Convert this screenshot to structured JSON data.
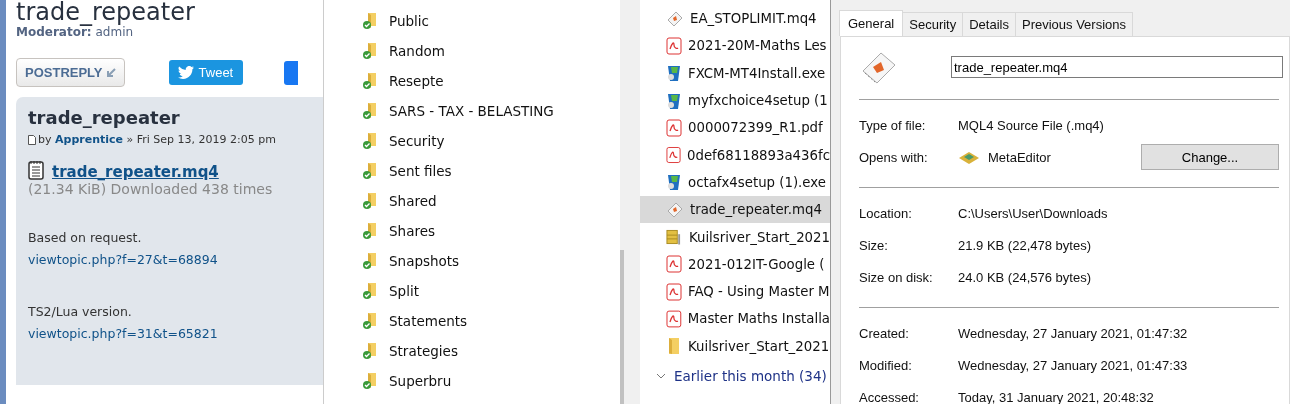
{
  "forum": {
    "title": "trade_repeater",
    "moderator_label": "Moderator:",
    "moderator": "admin",
    "post_reply": "POSTREPLY",
    "tweet": "Tweet",
    "post": {
      "title": "trade_repeater",
      "by": "by",
      "author": "Apprentice",
      "date": "» Fri Sep 13, 2019 2:05 pm",
      "attachment": "trade_repeater.mq4",
      "attachment_info": "(21.34 KiB) Downloaded 438 times",
      "paragraphs": [
        {
          "text": "Based on request.",
          "link": "viewtopic.php?f=27&t=68894"
        },
        {
          "text": "TS2/Lua version.",
          "link": "viewtopic.php?f=31&t=65821"
        }
      ]
    }
  },
  "folders": [
    {
      "name": "Public"
    },
    {
      "name": "Random"
    },
    {
      "name": "Resepte"
    },
    {
      "name": "SARS - TAX - BELASTING"
    },
    {
      "name": "Security"
    },
    {
      "name": "Sent files"
    },
    {
      "name": "Shared"
    },
    {
      "name": "Shares"
    },
    {
      "name": "Snapshots"
    },
    {
      "name": "Split"
    },
    {
      "name": "Statements"
    },
    {
      "name": "Strategies"
    },
    {
      "name": "Superbru"
    }
  ],
  "files": [
    {
      "name": "EA_STOPLIMIT.mq4",
      "kind": "mq4",
      "selected": false
    },
    {
      "name": "2021-20M-Maths Les",
      "kind": "pdf",
      "selected": false
    },
    {
      "name": "FXCM-MT4Install.exe",
      "kind": "exe",
      "selected": false
    },
    {
      "name": "myfxchoice4setup (1",
      "kind": "exe",
      "selected": false
    },
    {
      "name": "0000072399_R1.pdf",
      "kind": "pdf",
      "selected": false
    },
    {
      "name": "0def68118893a436fc",
      "kind": "pdf",
      "selected": false
    },
    {
      "name": "octafx4setup (1).exe",
      "kind": "exe",
      "selected": false
    },
    {
      "name": "trade_repeater.mq4",
      "kind": "mq4",
      "selected": true
    },
    {
      "name": "Kuilsriver_Start_2021",
      "kind": "archive",
      "selected": false
    },
    {
      "name": "2021-012IT-Google (",
      "kind": "pdf",
      "selected": false
    },
    {
      "name": "FAQ - Using Master M",
      "kind": "pdf",
      "selected": false
    },
    {
      "name": "Master Maths Installa",
      "kind": "pdf",
      "selected": false
    },
    {
      "name": "Kuilsriver_Start_2021",
      "kind": "folder",
      "selected": false
    }
  ],
  "group": {
    "label": "Earlier this month (34)",
    "expanded": true
  },
  "properties": {
    "tabs": [
      {
        "label": "General",
        "selected": true
      },
      {
        "label": "Security",
        "selected": false
      },
      {
        "label": "Details",
        "selected": false
      },
      {
        "label": "Previous Versions",
        "selected": false
      }
    ],
    "filename": "trade_repeater.mq4",
    "type_label": "Type of file:",
    "type": "MQL4 Source File (.mq4)",
    "opens_label": "Opens with:",
    "opens": "MetaEditor",
    "change": "Change...",
    "groups": [
      [
        {
          "label": "Location:",
          "value": "C:\\Users\\User\\Downloads"
        },
        {
          "label": "Size:",
          "value": "21.9 KB (22,478 bytes)"
        },
        {
          "label": "Size on disk:",
          "value": "24.0 KB (24,576 bytes)"
        }
      ],
      [
        {
          "label": "Created:",
          "value": "Wednesday, 27 January 2021, 01:47:32"
        },
        {
          "label": "Modified:",
          "value": "Wednesday, 27 January 2021, 01:47:33"
        },
        {
          "label": "Accessed:",
          "value": "Today, 31 January 2021, 20:48:32"
        }
      ]
    ]
  }
}
